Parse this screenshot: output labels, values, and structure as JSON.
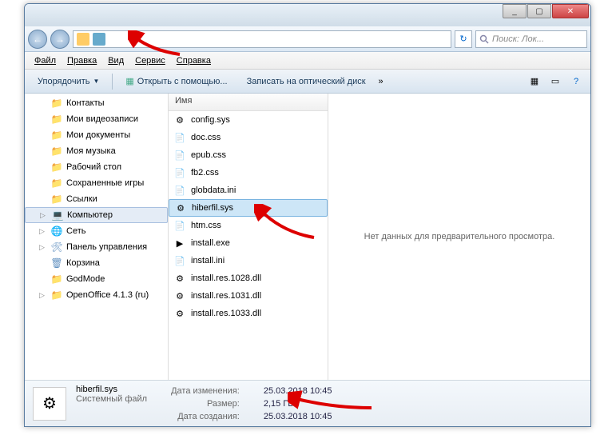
{
  "titlebar": {
    "min": "_",
    "max": "▢",
    "close": "✕"
  },
  "nav": {
    "back": "←",
    "fwd": "→",
    "refresh": "↻"
  },
  "search": {
    "placeholder": "Поиск: Лок..."
  },
  "menu": {
    "file": "Файл",
    "edit": "Правка",
    "view": "Вид",
    "tools": "Сервис",
    "help": "Справка"
  },
  "toolbar": {
    "organize": "Упорядочить",
    "openwith": "Открыть с помощью...",
    "burn": "Записать на оптический диск"
  },
  "tree": {
    "items": [
      {
        "icon": "folder",
        "label": "Контакты"
      },
      {
        "icon": "folder",
        "label": "Мои видеозаписи"
      },
      {
        "icon": "folder",
        "label": "Мои документы"
      },
      {
        "icon": "folder",
        "label": "Моя музыка"
      },
      {
        "icon": "folder",
        "label": "Рабочий стол"
      },
      {
        "icon": "folder",
        "label": "Сохраненные игры"
      },
      {
        "icon": "folder",
        "label": "Ссылки"
      },
      {
        "icon": "computer",
        "label": "Компьютер",
        "selected": true,
        "exp": "▷"
      },
      {
        "icon": "network",
        "label": "Сеть",
        "exp": "▷"
      },
      {
        "icon": "cpanel",
        "label": "Панель управления",
        "exp": "▷"
      },
      {
        "icon": "recycle",
        "label": "Корзина"
      },
      {
        "icon": "folder",
        "label": "GodMode"
      },
      {
        "icon": "folder",
        "label": "OpenOffice 4.1.3 (ru)",
        "exp": "▷"
      }
    ]
  },
  "list": {
    "colheader": "Имя",
    "files": [
      {
        "icon": "sys",
        "name": "config.sys"
      },
      {
        "icon": "css",
        "name": "doc.css"
      },
      {
        "icon": "css",
        "name": "epub.css"
      },
      {
        "icon": "css",
        "name": "fb2.css"
      },
      {
        "icon": "ini",
        "name": "globdata.ini"
      },
      {
        "icon": "sys",
        "name": "hiberfil.sys",
        "selected": true
      },
      {
        "icon": "css",
        "name": "htm.css"
      },
      {
        "icon": "exe",
        "name": "install.exe"
      },
      {
        "icon": "ini",
        "name": "install.ini"
      },
      {
        "icon": "dll",
        "name": "install.res.1028.dll"
      },
      {
        "icon": "dll",
        "name": "install.res.1031.dll"
      },
      {
        "icon": "dll",
        "name": "install.res.1033.dll"
      }
    ]
  },
  "preview": {
    "empty": "Нет данных для предварительного просмотра."
  },
  "details": {
    "filename": "hiberfil.sys",
    "filetype": "Системный файл",
    "mod_label": "Дата изменения:",
    "mod_value": "25.03.2018 10:45",
    "size_label": "Размер:",
    "size_value": "2,15 ГБ",
    "created_label": "Дата создания:",
    "created_value": "25.03.2018 10:45"
  }
}
